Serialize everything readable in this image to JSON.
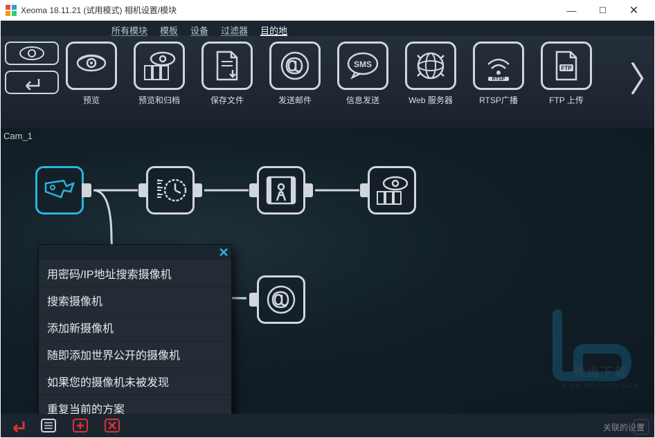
{
  "window": {
    "title": "Xeoma 18.11.21 (试用模式) 相机设置/模块"
  },
  "tabs": [
    {
      "label": "所有模块"
    },
    {
      "label": "模板"
    },
    {
      "label": "设备"
    },
    {
      "label": "过滤器"
    },
    {
      "label": "目的地"
    }
  ],
  "modules": [
    {
      "label": "预览",
      "icon": "eye"
    },
    {
      "label": "预览和归档",
      "icon": "eye-archive"
    },
    {
      "label": "保存文件",
      "icon": "file-save"
    },
    {
      "label": "发送邮件",
      "icon": "email"
    },
    {
      "label": "信息发送",
      "icon": "sms"
    },
    {
      "label": "Web 服务器",
      "icon": "web"
    },
    {
      "label": "RTSP广播",
      "icon": "rtsp"
    },
    {
      "label": "FTP 上传",
      "icon": "ftp"
    }
  ],
  "camera_label": "Cam_1",
  "chain_nodes": [
    {
      "icon": "camera",
      "selected": true
    },
    {
      "icon": "schedule"
    },
    {
      "icon": "motion"
    },
    {
      "icon": "eye-archive"
    }
  ],
  "detached_node": {
    "icon": "email"
  },
  "menu": {
    "items": [
      "用密码/IP地址搜索摄像机",
      "搜索摄像机",
      "添加新摄像机",
      "随即添加世界公开的摄像机",
      "如果您的摄像机未被发现",
      "重复当前的方案"
    ]
  },
  "footer": {
    "settings_text": "关联的设置"
  },
  "watermark": {
    "text": "微当下载",
    "url": "WWW.WEIDOWN.COM"
  }
}
